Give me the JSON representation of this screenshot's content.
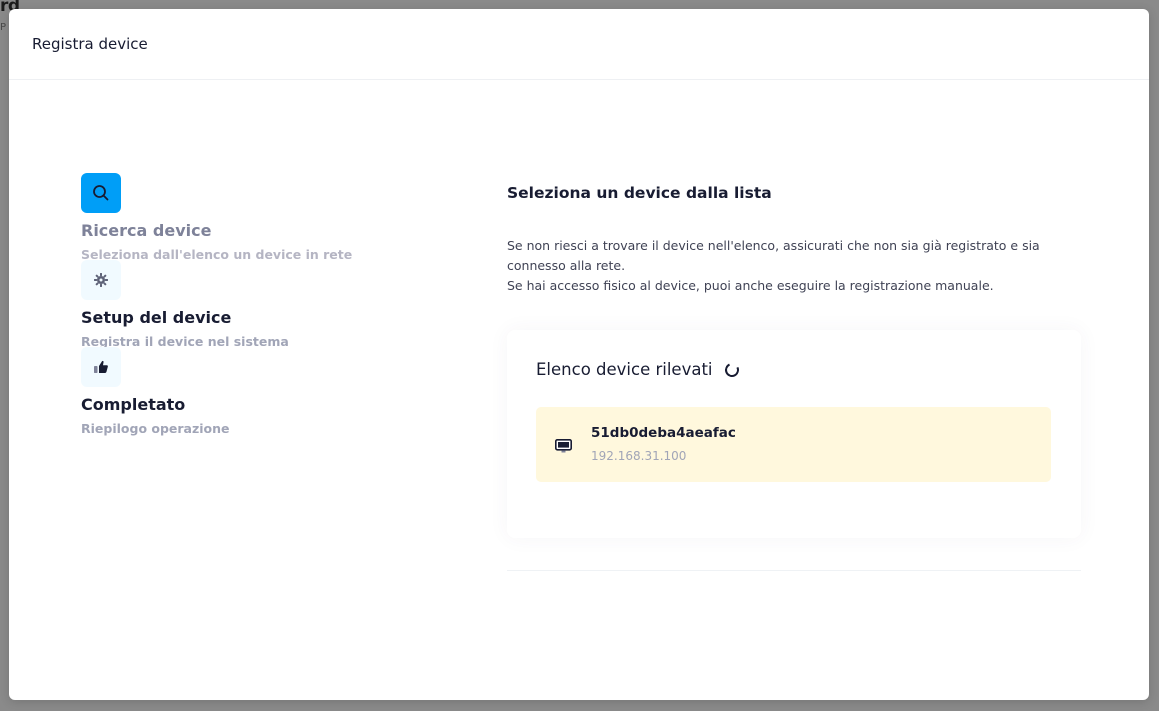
{
  "background": {
    "title_fragment": "rd",
    "subtitle_fragment": "P"
  },
  "modal": {
    "title": "Registra device"
  },
  "stepper": {
    "steps": [
      {
        "icon": "search-icon",
        "title": "Ricerca device",
        "description": "Seleziona dall'elenco un device in rete",
        "active": true
      },
      {
        "icon": "gear-icon",
        "title": "Setup del device",
        "description": "Registra il device nel sistema",
        "active": false
      },
      {
        "icon": "thumbs-up-icon",
        "title": "Completato",
        "description": "Riepilogo operazione",
        "active": false
      }
    ]
  },
  "content": {
    "heading": "Seleziona un device dalla lista",
    "paragraph_1": "Se non riesci a trovare il device nell'elenco, assicurati che non sia già registrato e sia connesso alla rete.",
    "paragraph_2": "Se hai accesso fisico al device, puoi anche eseguire la registrazione manuale.",
    "list_title": "Elenco device rilevati",
    "devices": [
      {
        "name": "51db0deba4aeafac",
        "ip": "192.168.31.100",
        "icon": "monitor-icon"
      }
    ]
  },
  "colors": {
    "accent": "#009ef7",
    "device_highlight": "#fff8dd",
    "overlay": "#7f7f7f"
  }
}
